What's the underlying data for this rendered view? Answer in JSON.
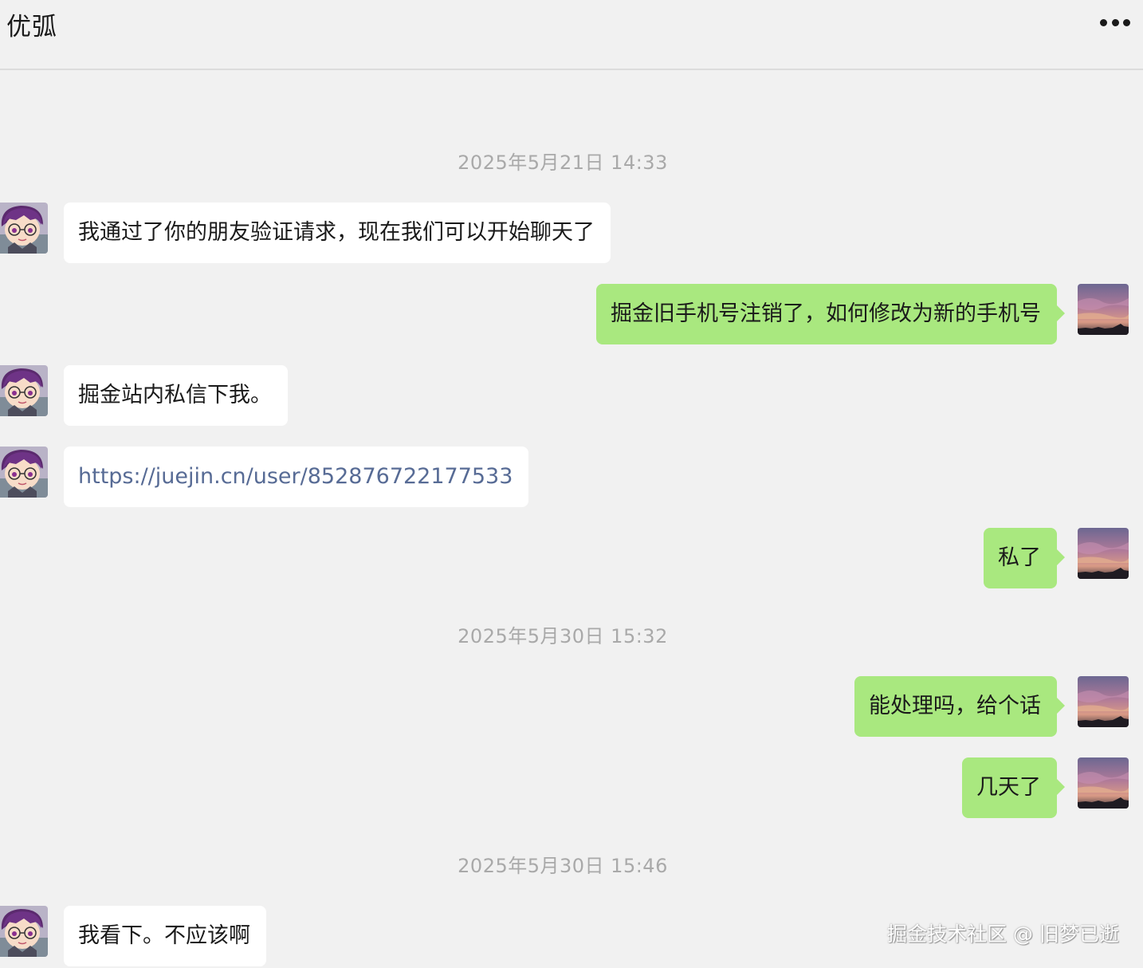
{
  "header": {
    "title": "优弧",
    "more_icon": "more-icon"
  },
  "timestamps": [
    "2025年5月21日 14:33",
    "2025年5月30日 15:32",
    "2025年5月30日 15:46"
  ],
  "messages": [
    {
      "side": "in",
      "text": "我通过了你的朋友验证请求，现在我们可以开始聊天了"
    },
    {
      "side": "out",
      "text": "掘金旧手机号注销了，如何修改为新的手机号"
    },
    {
      "side": "in",
      "text": "掘金站内私信下我。"
    },
    {
      "side": "in",
      "text": "https://juejin.cn/user/852876722177533"
    },
    {
      "side": "out",
      "text": "私了"
    },
    {
      "side": "out",
      "text": "能处理吗，给个话"
    },
    {
      "side": "out",
      "text": "几天了"
    },
    {
      "side": "in",
      "text": "我看下。不应该啊"
    }
  ],
  "watermark": "掘金技术社区 @ 旧梦已逝",
  "colors": {
    "background": "#f1f1f1",
    "incoming_bubble": "#ffffff",
    "outgoing_bubble": "#a9e87f",
    "link": "#576b95",
    "timestamp": "#a9a9a9"
  }
}
